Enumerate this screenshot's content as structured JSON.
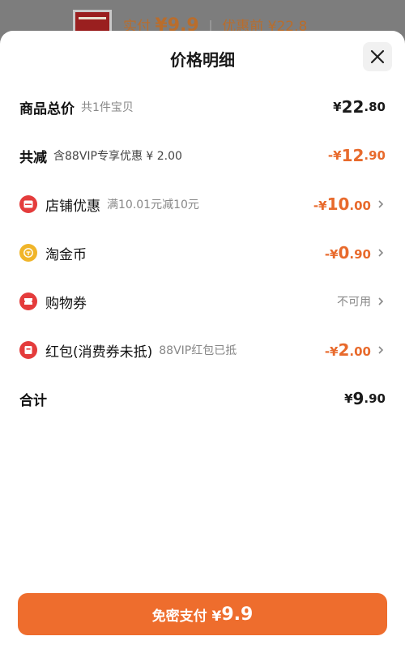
{
  "background": {
    "line1_prefix": "实付",
    "line1_price": "¥9.9",
    "line1_sep": "|",
    "line1_suffix": "优惠前 ¥22.8"
  },
  "sheet": {
    "title": "价格明细"
  },
  "rows": {
    "total": {
      "label": "商品总价",
      "sub": "共1件宝贝",
      "currency": "¥",
      "int": "22",
      "dec": ".80"
    },
    "reduce": {
      "label": "共减",
      "sub": "含88VIP专享优惠 ¥ 2.00",
      "prefix": "-¥",
      "int": "12",
      "dec": ".90"
    },
    "shop": {
      "label": "店铺优惠",
      "sub": "满10.01元减10元",
      "prefix": "-¥",
      "int": "10",
      "dec": ".00"
    },
    "coin": {
      "label": "淘金币",
      "prefix": "-¥",
      "int": "0",
      "dec": ".90"
    },
    "coupon": {
      "label": "购物券",
      "status": "不可用"
    },
    "redpack": {
      "label": "红包(消费券未抵)",
      "sub": "88VIP红包已抵",
      "prefix": "-¥",
      "int": "2",
      "dec": ".00"
    },
    "sum": {
      "label": "合计",
      "currency": "¥",
      "int": "9",
      "dec": ".90"
    }
  },
  "pay": {
    "label": "免密支付 ¥",
    "amount": "9.9"
  },
  "colors": {
    "accent": "#ee6d2d",
    "orange_text": "#e86a2c",
    "red_icon": "#e43c3c",
    "gold_icon": "#f0b52a"
  }
}
